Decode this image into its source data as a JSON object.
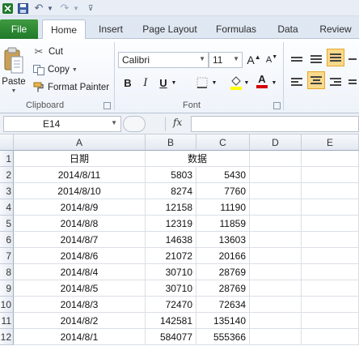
{
  "ribbon_tabs": [
    "File",
    "Home",
    "Insert",
    "Page Layout",
    "Formulas",
    "Data",
    "Review"
  ],
  "clipboard": {
    "paste": "Paste",
    "cut": "Cut",
    "copy": "Copy",
    "format_painter": "Format Painter",
    "group_label": "Clipboard"
  },
  "font": {
    "family": "Calibri",
    "size": "11",
    "grow_label": "A",
    "shrink_label": "A",
    "bold": "B",
    "italic": "I",
    "underline": "U",
    "font_color_label": "A",
    "group_label": "Font"
  },
  "formula_bar": {
    "name_box": "E14",
    "fx": "fx",
    "value": ""
  },
  "columns": [
    "A",
    "B",
    "C",
    "D",
    "E"
  ],
  "rows": [
    {
      "num": "1",
      "a": "日期",
      "b": "数据",
      "c": ""
    },
    {
      "num": "2",
      "a": "2014/8/11",
      "b": "5803",
      "c": "5430"
    },
    {
      "num": "3",
      "a": "2014/8/10",
      "b": "8274",
      "c": "7760"
    },
    {
      "num": "4",
      "a": "2014/8/9",
      "b": "12158",
      "c": "11190"
    },
    {
      "num": "5",
      "a": "2014/8/8",
      "b": "12319",
      "c": "11859"
    },
    {
      "num": "6",
      "a": "2014/8/7",
      "b": "14638",
      "c": "13603"
    },
    {
      "num": "7",
      "a": "2014/8/6",
      "b": "21072",
      "c": "20166"
    },
    {
      "num": "8",
      "a": "2014/8/4",
      "b": "30710",
      "c": "28769"
    },
    {
      "num": "9",
      "a": "2014/8/5",
      "b": "30710",
      "c": "28769"
    },
    {
      "num": "10",
      "a": "2014/8/3",
      "b": "72470",
      "c": "72634"
    },
    {
      "num": "11",
      "a": "2014/8/2",
      "b": "142581",
      "c": "135140"
    },
    {
      "num": "12",
      "a": "2014/8/1",
      "b": "584077",
      "c": "555366"
    }
  ],
  "icons": {
    "save": "save-icon",
    "undo": "undo-icon",
    "redo": "redo-icon",
    "customize": "customize-qat-icon"
  },
  "colors": {
    "file_tab": "#1f7a2b",
    "highlight": "#ffff00",
    "font_color": "#d40000",
    "selected_button": "#fbd98a"
  }
}
